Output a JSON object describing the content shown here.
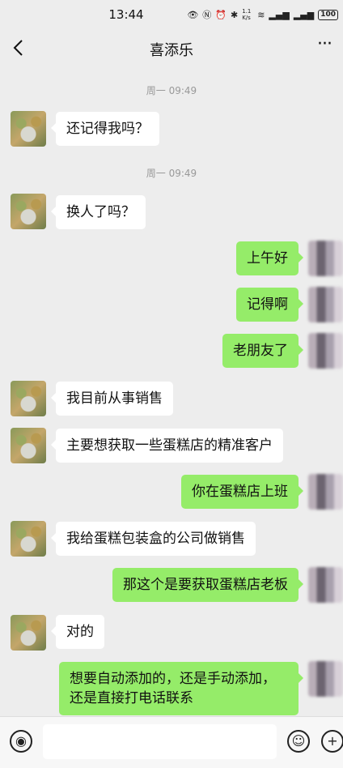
{
  "status": {
    "time": "13:44",
    "net_speed": "1.1 K/s",
    "battery": "100"
  },
  "nav": {
    "title": "喜添乐"
  },
  "chat": {
    "timestamps": [
      "周一 09:49",
      "周一 09:49"
    ],
    "messages": [
      {
        "side": "left",
        "text": "还记得我吗？"
      },
      {
        "side": "left",
        "text": "换人了吗？"
      },
      {
        "side": "right",
        "text": "上午好"
      },
      {
        "side": "right",
        "text": "记得啊"
      },
      {
        "side": "right",
        "text": "老朋友了"
      },
      {
        "side": "left",
        "text": "我目前从事销售"
      },
      {
        "side": "left",
        "text": "主要想获取一些蛋糕店的精准客户"
      },
      {
        "side": "right",
        "text": "你在蛋糕店上班"
      },
      {
        "side": "left",
        "text": "我给蛋糕包装盒的公司做销售"
      },
      {
        "side": "right",
        "text": "那这个是要获取蛋糕店老板"
      },
      {
        "side": "left",
        "text": "对的"
      },
      {
        "side": "right",
        "text": "想要自动添加的，还是手动添加，还是直接打电话联系"
      }
    ]
  },
  "colors": {
    "background": "#ededed",
    "sent_bubble": "#95ec69",
    "received_bubble": "#ffffff"
  },
  "icons": [
    "back-arrow-icon",
    "more-icon",
    "voice-icon",
    "emoji-icon",
    "plus-icon"
  ]
}
